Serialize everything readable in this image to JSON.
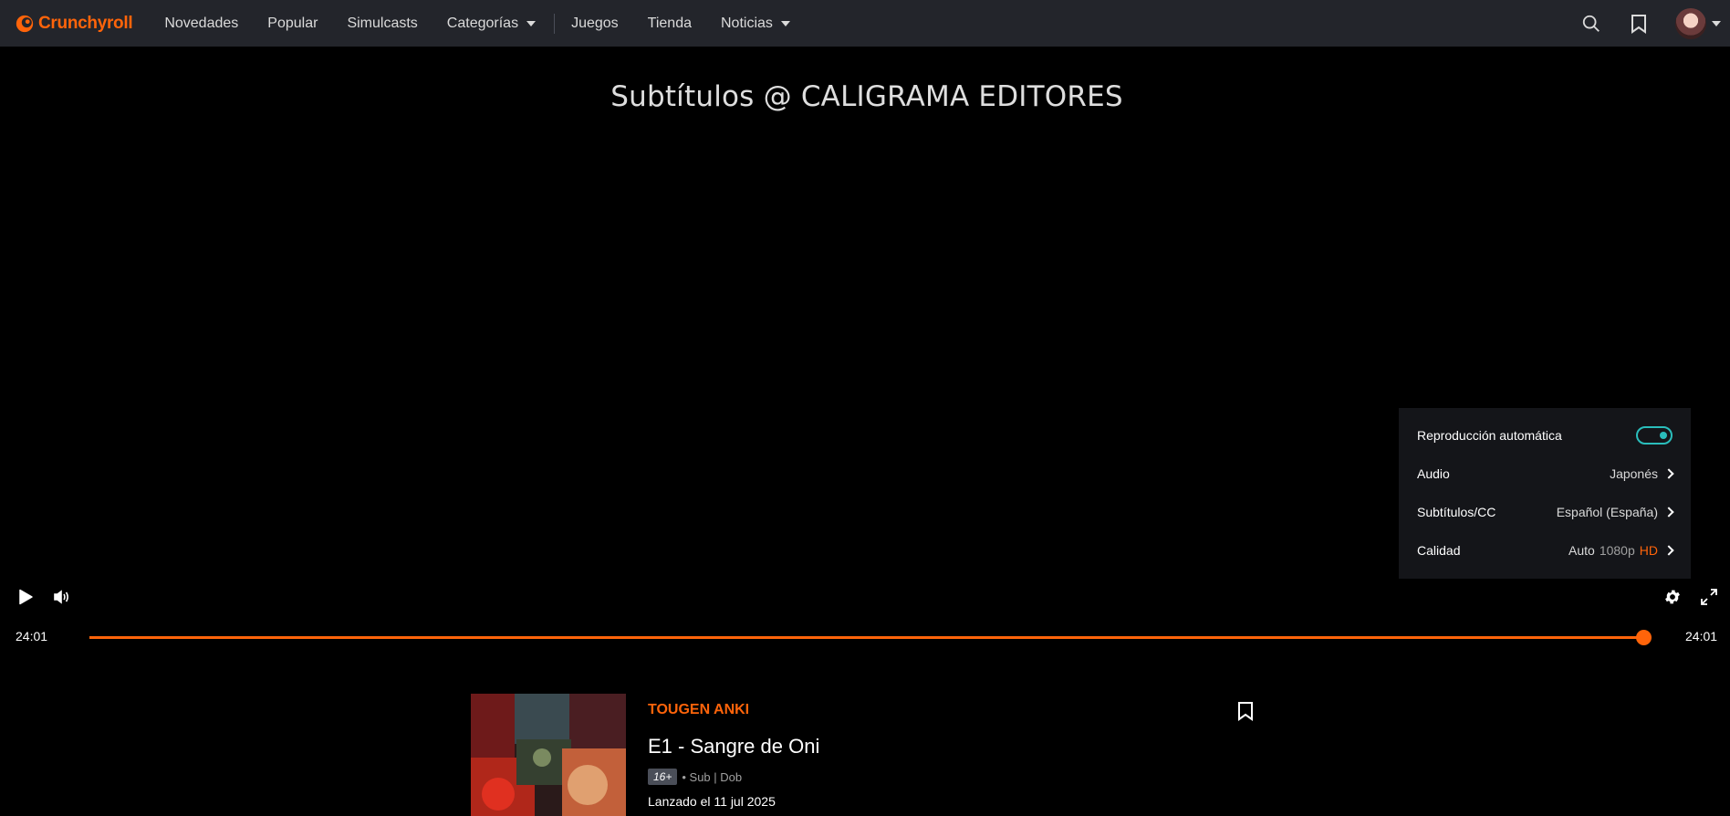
{
  "nav": {
    "logo_text": "Crunchyroll",
    "items": [
      {
        "label": "Novedades",
        "has_dropdown": false
      },
      {
        "label": "Popular",
        "has_dropdown": false
      },
      {
        "label": "Simulcasts",
        "has_dropdown": false
      },
      {
        "label": "Categorías",
        "has_dropdown": true
      },
      {
        "label": "Juegos",
        "has_dropdown": false
      },
      {
        "label": "Tienda",
        "has_dropdown": false
      },
      {
        "label": "Noticias",
        "has_dropdown": true
      }
    ],
    "right_icons": [
      "search-icon",
      "bookmark-icon"
    ],
    "accent_color": "#ff640a"
  },
  "player": {
    "subtitle_text": "Subtítulos @ CALIGRAMA EDITORES",
    "current_time": "24:01",
    "duration": "24:01",
    "progress_fraction": 1.0,
    "settings": {
      "autoplay_label": "Reproducción automática",
      "autoplay_on": true,
      "audio_label": "Audio",
      "audio_value": "Japonés",
      "subtitles_label": "Subtítulos/CC",
      "subtitles_value": "Español (España)",
      "quality_label": "Calidad",
      "quality_auto": "Auto",
      "quality_res": "1080p",
      "quality_hd": "HD"
    }
  },
  "episode": {
    "series": "TOUGEN ANKI",
    "title": "E1 - Sangre de Oni",
    "rating": "16+",
    "formats": "• Sub | Dob",
    "release": "Lanzado el 11 jul 2025"
  }
}
